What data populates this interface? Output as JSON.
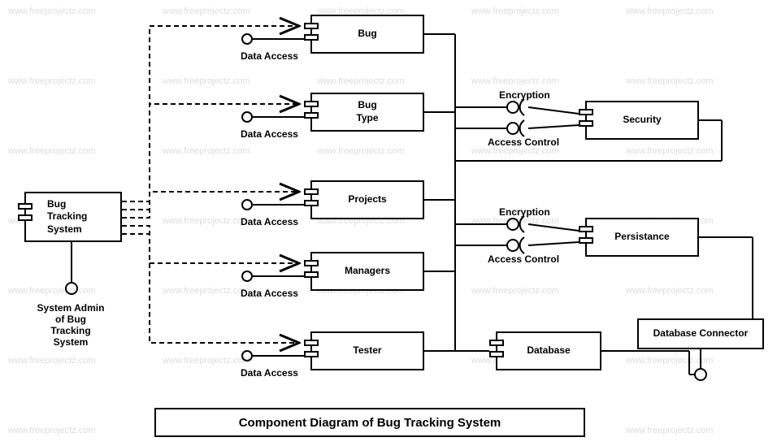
{
  "title": "Component Diagram of Bug Tracking System",
  "watermark": "www.freeprojectz.com",
  "system": {
    "main": "Bug\nTracking\nSystem",
    "admin": "System Admin\nof Bug\nTracking\nSystem"
  },
  "components": {
    "bug": "Bug",
    "bugtype": "Bug\nType",
    "projects": "Projects",
    "managers": "Managers",
    "tester": "Tester",
    "security": "Security",
    "persistance": "Persistance",
    "database": "Database",
    "dbconnector": "Database Connector"
  },
  "labels": {
    "data_access": "Data Access",
    "encryption": "Encryption",
    "access_control": "Access Control"
  },
  "chart_data": {
    "type": "diagram",
    "name": "UML Component Diagram",
    "root": "Bug Tracking System",
    "root_interface": "System Admin of Bug Tracking System",
    "middle_components": [
      {
        "name": "Bug",
        "provides": "Data Access"
      },
      {
        "name": "Bug Type",
        "provides": "Data Access"
      },
      {
        "name": "Projects",
        "provides": "Data Access"
      },
      {
        "name": "Managers",
        "provides": "Data Access"
      },
      {
        "name": "Tester",
        "provides": "Data Access"
      }
    ],
    "right_components": [
      {
        "name": "Security",
        "requires": [
          "Encryption",
          "Access Control"
        ]
      },
      {
        "name": "Persistance",
        "requires": [
          "Encryption",
          "Access Control"
        ]
      },
      {
        "name": "Database",
        "connects_to": "Database Connector"
      }
    ]
  }
}
